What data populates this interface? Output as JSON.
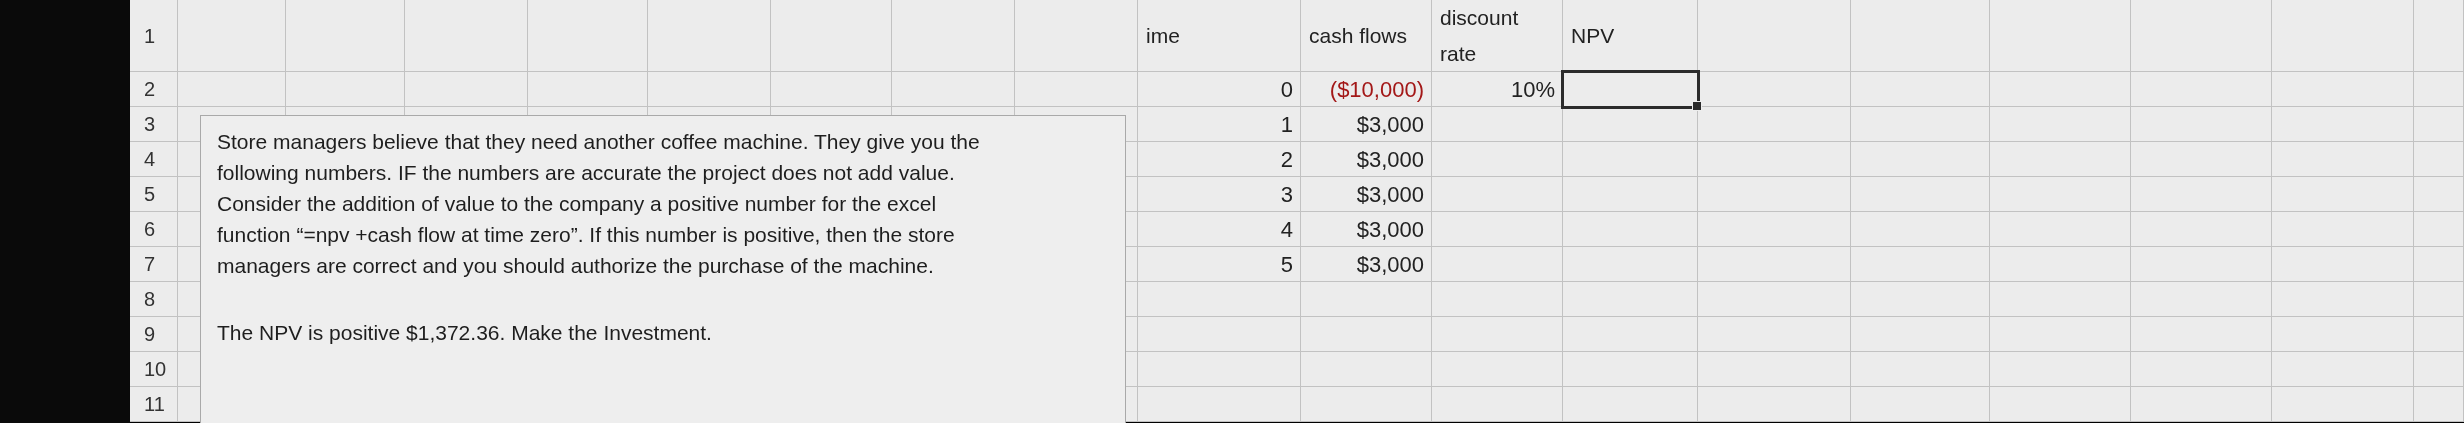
{
  "row_numbers": [
    "1",
    "2",
    "3",
    "4",
    "5",
    "6",
    "7",
    "8",
    "9",
    "10",
    "11"
  ],
  "headers": [
    "ime",
    "cash flows",
    "discount rate",
    "NPV"
  ],
  "rows": [
    {
      "time": "0",
      "cash_flow": "($10,000)",
      "negative": true,
      "discount_rate": "10%",
      "npv_selected": true
    },
    {
      "time": "1",
      "cash_flow": "$3,000",
      "negative": false,
      "npv_selected": false
    },
    {
      "time": "2",
      "cash_flow": "$3,000",
      "negative": false,
      "npv_selected": false
    },
    {
      "time": "3",
      "cash_flow": "$3,000",
      "negative": false,
      "npv_selected": false
    },
    {
      "time": "4",
      "cash_flow": "$3,000",
      "negative": false,
      "npv_selected": false
    },
    {
      "time": "5",
      "cash_flow": "$3,000",
      "negative": false,
      "npv_selected": false
    }
  ],
  "text_box": {
    "paragraphs": [
      "Store managers believe that they need another coffee machine.  They give you the\nfollowing numbers. IF the numbers are accurate the project does not add value.\nConsider the addition of value to the company a positive number for the excel\nfunction “=npv +cash flow at time zero”. If this number is positive, then the store\nmanagers are correct and you should authorize the purchase of the machine.",
      "The NPV is positive $1,372.36. Make the Investment."
    ]
  }
}
